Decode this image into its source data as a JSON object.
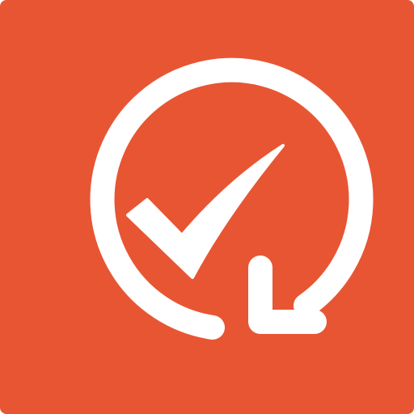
{
  "icon": {
    "name": "recurring-task-check-icon",
    "background_color": "#E85533",
    "foreground_color": "#FFFFFF"
  }
}
